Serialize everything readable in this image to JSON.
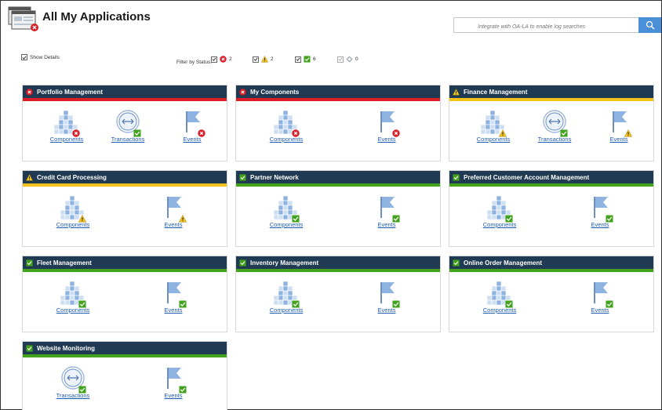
{
  "header": {
    "title": "All My Applications",
    "logo_icon": "applications-window-icon",
    "search_placeholder": "Integrate with OA-LA to enable log searches",
    "search_icon": "search-icon"
  },
  "options": {
    "show_details_label": "Show Details",
    "filter_label": "Filter by Status:",
    "filters": [
      {
        "status": "critical",
        "count": "2",
        "checked": true,
        "enabled": true
      },
      {
        "status": "warning",
        "count": "2",
        "checked": true,
        "enabled": true
      },
      {
        "status": "normal",
        "count": "6",
        "checked": true,
        "enabled": true
      },
      {
        "status": "unknown",
        "count": "0",
        "checked": true,
        "enabled": false
      }
    ]
  },
  "colors": {
    "header_bg": "#1f3a52",
    "critical": "#da1e28",
    "warning": "#f1c21b",
    "normal": "#42a21b",
    "link": "#1f5db4",
    "search_button": "#4a90d9"
  },
  "applications": [
    {
      "name": "Portfolio Management",
      "status": "critical",
      "items": [
        {
          "type": "components",
          "label": "Components",
          "status": "critical"
        },
        {
          "type": "transactions",
          "label": "Transactions",
          "status": "normal"
        },
        {
          "type": "events",
          "label": "Events",
          "status": "critical"
        }
      ]
    },
    {
      "name": "My Components",
      "status": "critical",
      "items": [
        {
          "type": "components",
          "label": "Components",
          "status": "critical"
        },
        {
          "type": "events",
          "label": "Events",
          "status": "critical"
        }
      ]
    },
    {
      "name": "Finance Management",
      "status": "warning",
      "items": [
        {
          "type": "components",
          "label": "Components",
          "status": "warning"
        },
        {
          "type": "transactions",
          "label": "Transactions",
          "status": "normal"
        },
        {
          "type": "events",
          "label": "Events",
          "status": "warning"
        }
      ]
    },
    {
      "name": "Credit Card Processing",
      "status": "warning",
      "items": [
        {
          "type": "components",
          "label": "Components",
          "status": "warning"
        },
        {
          "type": "events",
          "label": "Events",
          "status": "warning"
        }
      ]
    },
    {
      "name": "Partner Network",
      "status": "normal",
      "items": [
        {
          "type": "components",
          "label": "Components",
          "status": "normal"
        },
        {
          "type": "events",
          "label": "Events",
          "status": "normal"
        }
      ]
    },
    {
      "name": "Preferred Customer Account Management",
      "status": "normal",
      "items": [
        {
          "type": "components",
          "label": "Components",
          "status": "normal"
        },
        {
          "type": "events",
          "label": "Events",
          "status": "normal"
        }
      ]
    },
    {
      "name": "Fleet Management",
      "status": "normal",
      "items": [
        {
          "type": "components",
          "label": "Components",
          "status": "normal"
        },
        {
          "type": "events",
          "label": "Events",
          "status": "normal"
        }
      ]
    },
    {
      "name": "Inventory Management",
      "status": "normal",
      "items": [
        {
          "type": "components",
          "label": "Components",
          "status": "normal"
        },
        {
          "type": "events",
          "label": "Events",
          "status": "normal"
        }
      ]
    },
    {
      "name": "Online Order Management",
      "status": "normal",
      "items": [
        {
          "type": "components",
          "label": "Components",
          "status": "normal"
        },
        {
          "type": "events",
          "label": "Events",
          "status": "normal"
        }
      ]
    },
    {
      "name": "Website Monitoring",
      "status": "normal",
      "items": [
        {
          "type": "transactions",
          "label": "Transactions",
          "status": "normal"
        },
        {
          "type": "events",
          "label": "Events",
          "status": "normal"
        }
      ]
    }
  ]
}
